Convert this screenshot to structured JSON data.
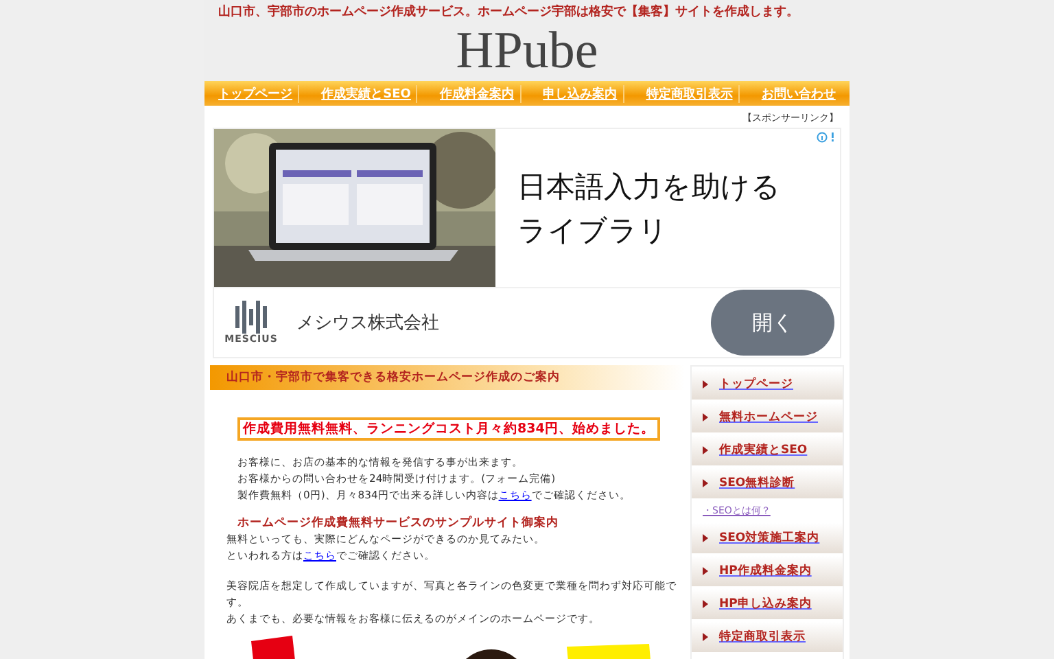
{
  "header": {
    "tagline": "山口市、宇部市のホームページ作成サービス。ホームページ宇部は格安で【集客】サイトを作成します。",
    "logo": "HPube"
  },
  "nav": [
    "トップページ",
    "作成実績とSEO",
    "作成料金案内",
    "申し込み案内",
    "特定商取引表示",
    "お問い合わせ"
  ],
  "sponsor_label": "【スポンサーリンク】",
  "ad": {
    "headline": "日本語入力を助ける",
    "headline_2": "ライブラリ",
    "brand_mark": "MESCIUS",
    "advertiser": "メシウス株式会社",
    "button": "開く"
  },
  "main": {
    "section_title": "山口市・宇部市で集客できる格安ホームページ作成のご案内",
    "highlight": "作成費用無料無料、ランニングコスト月々約834円、始めました。",
    "intro_lines": [
      "お客様に、お店の基本的な情報を発信する事が出来ます。",
      "お客様からの問い合わせを24時間受け付けます。(フォーム完備)"
    ],
    "intro_link_line": {
      "before": "製作費無料（0円)、月々834円で出来る詳しい内容は",
      "link": "こちら",
      "after": "でご確認ください。"
    },
    "sample_heading": "ホームページ作成費無料サービスのサンプルサイト御案内",
    "sample_line": "無料といっても、実際にどんなページができるのか見てみたい。",
    "sample_link_line": {
      "before": "といわれる方は",
      "link": "こちら",
      "after": "でご確認ください。"
    },
    "body": [
      "美容院店を想定して作成していますが、写真と各ラインの色変更で業種を問わず対応可能です。",
      "あくまでも、必要な情報をお客様に伝えるのがメインのホームページです。"
    ]
  },
  "sidebar": [
    {
      "kind": "button",
      "label": "トップページ"
    },
    {
      "kind": "button",
      "label": "無料ホームページ"
    },
    {
      "kind": "button",
      "label": "作成実績とSEO"
    },
    {
      "kind": "button",
      "label": "SEO無料診断"
    },
    {
      "kind": "sublink",
      "label": "・SEOとは何？"
    },
    {
      "kind": "button",
      "label": "SEO対策施工案内"
    },
    {
      "kind": "button",
      "label": "HP作成料金案内"
    },
    {
      "kind": "button",
      "label": "HP申し込み案内"
    },
    {
      "kind": "button",
      "label": "特定商取引表示"
    }
  ]
}
